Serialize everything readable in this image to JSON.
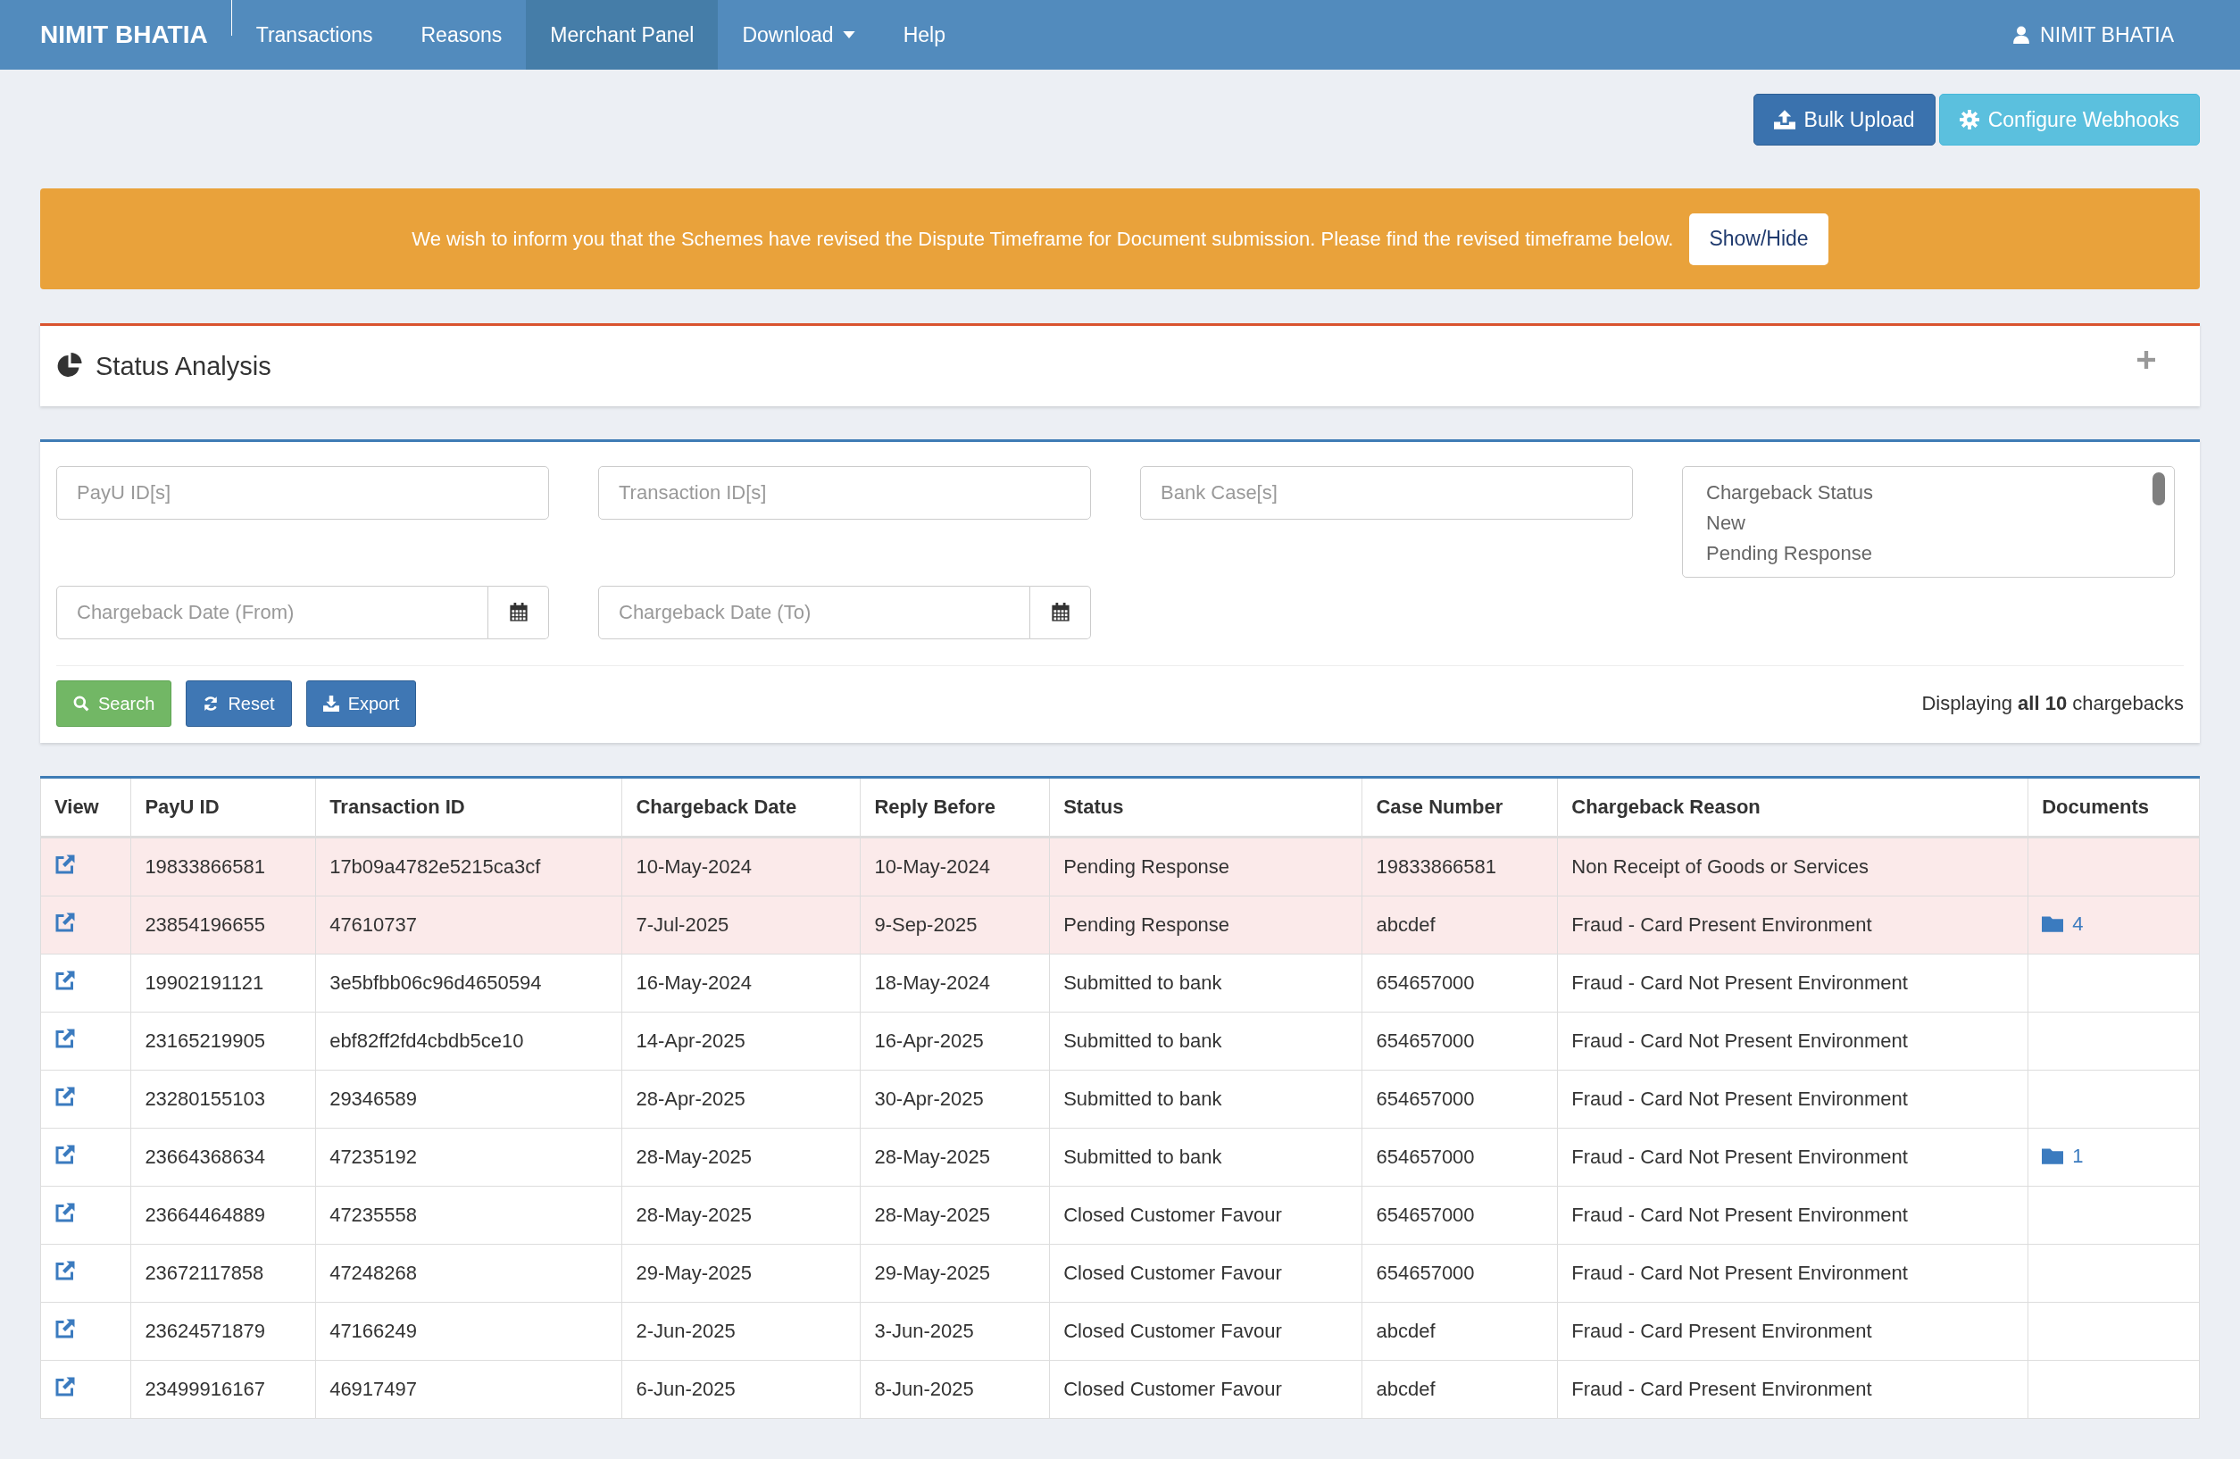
{
  "navbar": {
    "brand": "NIMIT BHATIA",
    "items": [
      {
        "label": "Transactions",
        "selected": false,
        "kind": "link"
      },
      {
        "label": "Reasons",
        "selected": false,
        "kind": "link"
      },
      {
        "label": "Merchant Panel",
        "selected": true,
        "kind": "link"
      },
      {
        "label": "Download",
        "selected": false,
        "kind": "dropdown"
      },
      {
        "label": "Help",
        "selected": false,
        "kind": "link"
      }
    ],
    "user": "NIMIT BHATIA"
  },
  "actions": [
    {
      "label": "Bulk Upload",
      "kind": "upload"
    },
    {
      "label": "Configure Webhooks",
      "kind": "webhooks"
    }
  ],
  "notice": {
    "text": "We wish to inform you that the Schemes have revised the Dispute Timeframe for Document submission. Please find the revised timeframe below.",
    "button": "Show/Hide"
  },
  "status_panel": {
    "title": "Status Analysis",
    "expanded": false
  },
  "filters": {
    "fields": [
      {
        "placeholder": "PayU ID[s]",
        "kind": "text"
      },
      {
        "placeholder": "Transaction ID[s]",
        "kind": "text"
      },
      {
        "placeholder": "Bank Case[s]",
        "kind": "text"
      },
      {
        "placeholder": "Chargeback Date (From)",
        "kind": "date"
      },
      {
        "placeholder": "Chargeback Date (To)",
        "kind": "date"
      }
    ],
    "status_list": [
      "Chargeback Status",
      "New",
      "Pending Response"
    ],
    "buttons": [
      {
        "label": "Search",
        "kind": "search"
      },
      {
        "label": "Reset",
        "kind": "reset"
      },
      {
        "label": "Export",
        "kind": "export"
      }
    ],
    "summary": "Displaying **all 10** chargebacks"
  },
  "table": {
    "columns": [
      "View",
      "PayU ID",
      "Transaction ID",
      "Chargeback Date",
      "Reply Before",
      "Status",
      "Case Number",
      "Chargeback Reason",
      "Documents"
    ],
    "rows": [
      {
        "highlighted": true,
        "cells": [
          "",
          "19833866581",
          "17b09a4782e5215ca3cf",
          "10-May-2024",
          "10-May-2024",
          "Pending Response",
          "19833866581",
          "Non Receipt of Goods or Services",
          ""
        ]
      },
      {
        "highlighted": true,
        "cells": [
          "",
          "23854196655",
          "47610737",
          "7-Jul-2025",
          "9-Sep-2025",
          "Pending Response",
          "abcdef",
          "Fraud - Card Present Environment",
          "4"
        ]
      },
      {
        "highlighted": false,
        "cells": [
          "",
          "19902191121",
          "3e5bfbb06c96d4650594",
          "16-May-2024",
          "18-May-2024",
          "Submitted to bank",
          "654657000",
          "Fraud - Card Not Present Environment",
          ""
        ]
      },
      {
        "highlighted": false,
        "cells": [
          "",
          "23165219905",
          "ebf82ff2fd4cbdb5ce10",
          "14-Apr-2025",
          "16-Apr-2025",
          "Submitted to bank",
          "654657000",
          "Fraud - Card Not Present Environment",
          ""
        ]
      },
      {
        "highlighted": false,
        "cells": [
          "",
          "23280155103",
          "29346589",
          "28-Apr-2025",
          "30-Apr-2025",
          "Submitted to bank",
          "654657000",
          "Fraud - Card Not Present Environment",
          ""
        ]
      },
      {
        "highlighted": false,
        "cells": [
          "",
          "23664368634",
          "47235192",
          "28-May-2025",
          "28-May-2025",
          "Submitted to bank",
          "654657000",
          "Fraud - Card Not Present Environment",
          "1"
        ]
      },
      {
        "highlighted": false,
        "cells": [
          "",
          "23664464889",
          "47235558",
          "28-May-2025",
          "28-May-2025",
          "Closed Customer Favour",
          "654657000",
          "Fraud - Card Not Present Environment",
          ""
        ]
      },
      {
        "highlighted": false,
        "cells": [
          "",
          "23672117858",
          "47248268",
          "29-May-2025",
          "29-May-2025",
          "Closed Customer Favour",
          "654657000",
          "Fraud - Card Not Present Environment",
          ""
        ]
      },
      {
        "highlighted": false,
        "cells": [
          "",
          "23624571879",
          "47166249",
          "2-Jun-2025",
          "3-Jun-2025",
          "Closed Customer Favour",
          "abcdef",
          "Fraud - Card Present Environment",
          ""
        ]
      },
      {
        "highlighted": false,
        "cells": [
          "",
          "23499916167",
          "46917497",
          "6-Jun-2025",
          "8-Jun-2025",
          "Closed Customer Favour",
          "abcdef",
          "Fraud - Card Present Environment",
          ""
        ]
      }
    ]
  }
}
